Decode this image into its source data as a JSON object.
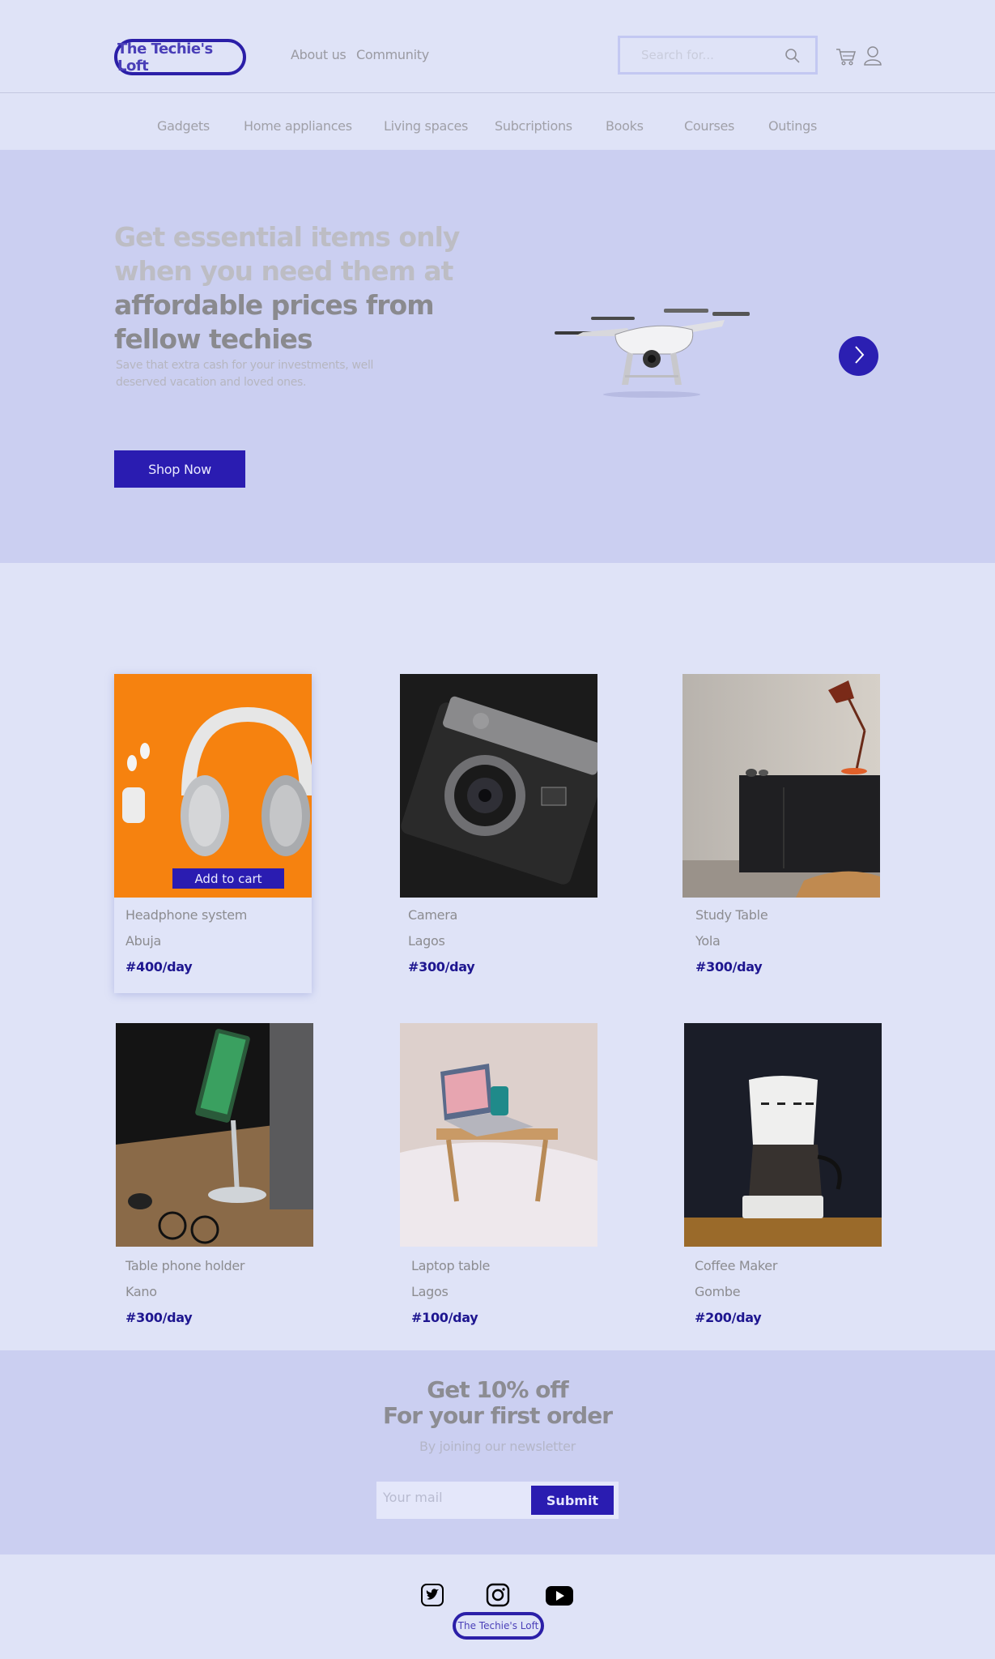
{
  "header": {
    "logo": "The Techie's Loft",
    "nav": [
      "About us",
      "Community"
    ],
    "search_placeholder": "Search for..."
  },
  "categories": [
    "Gadgets",
    "Home appliances",
    "Living spaces",
    "Subcriptions",
    "Books",
    "Courses",
    "Outings"
  ],
  "hero": {
    "title_light": "Get essential items only when you need them at ",
    "title_dark": "affordable prices from fellow techies",
    "subtitle": "Save that extra cash for your investments, well deserved vacation and loved ones.",
    "cta": "Shop Now"
  },
  "products": [
    {
      "name": "Headphone system",
      "location": "Abuja",
      "price": "#400/day",
      "add_to_cart": "Add to cart"
    },
    {
      "name": "Camera",
      "location": "Lagos",
      "price": "#300/day"
    },
    {
      "name": "Study Table",
      "location": "Yola",
      "price": "#300/day"
    },
    {
      "name": "Table phone holder",
      "location": "Kano",
      "price": "#300/day"
    },
    {
      "name": "Laptop table",
      "location": "Lagos",
      "price": "#100/day"
    },
    {
      "name": "Coffee Maker",
      "location": "Gombe",
      "price": "#200/day"
    }
  ],
  "newsletter": {
    "line1": "Get 10% off",
    "line2": "For your first order",
    "subtitle": "By joining our newsletter",
    "email_placeholder": "Your mail",
    "submit": "Submit"
  },
  "footer": {
    "logo": "The Techie's Loft",
    "social_icons": [
      "twitter-icon",
      "instagram-icon",
      "youtube-icon"
    ]
  },
  "colors": {
    "accent": "#2a1cb1",
    "background": "#dfe3f7",
    "hero_bg": "#cbcff1",
    "price": "#1e1690"
  }
}
